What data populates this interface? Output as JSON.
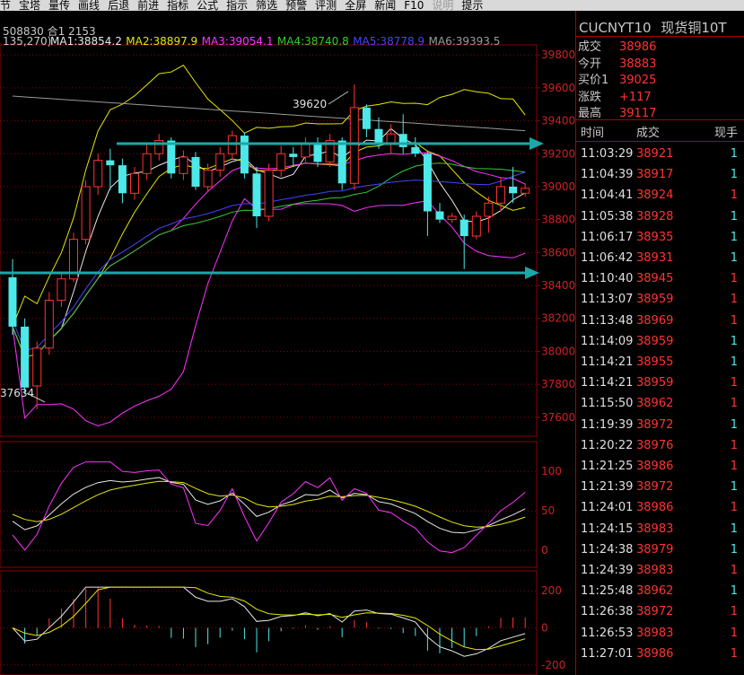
{
  "menu": [
    {
      "label": "节",
      "dim": false
    },
    {
      "label": "宝塔",
      "dim": false
    },
    {
      "label": "量传",
      "dim": false
    },
    {
      "label": "画线",
      "dim": false
    },
    {
      "label": "后退",
      "dim": false
    },
    {
      "label": "前进",
      "dim": false
    },
    {
      "label": "指标",
      "dim": false
    },
    {
      "label": "公式",
      "dim": false
    },
    {
      "label": "指示",
      "dim": false
    },
    {
      "label": "筛选",
      "dim": false
    },
    {
      "label": "预警",
      "dim": false
    },
    {
      "label": "评测",
      "dim": false
    },
    {
      "label": "全屏",
      "dim": false
    },
    {
      "label": "新闻",
      "dim": false
    },
    {
      "label": "F10",
      "dim": false
    },
    {
      "label": "说明",
      "dim": true
    },
    {
      "label": "提示",
      "dim": false
    }
  ],
  "info_line": "508830  合1 2153",
  "ma_legend": {
    "prefix": "135,270)",
    "items": [
      {
        "label": "MA1:38854.2",
        "color": "#e8e8e8"
      },
      {
        "label": "MA2:38897.9",
        "color": "#e6e600"
      },
      {
        "label": "MA3:39054.1",
        "color": "#ff33ff"
      },
      {
        "label": "MA4:38740.8",
        "color": "#33cc33"
      },
      {
        "label": "MA5:38778.9",
        "color": "#4444ff"
      },
      {
        "label": "MA6:39393.5",
        "color": "#9a9a9a"
      }
    ]
  },
  "price_axis": [
    "39800",
    "39600",
    "39400",
    "39200",
    "39000",
    "38800",
    "38600",
    "38400",
    "38200",
    "38000",
    "37800",
    "37600"
  ],
  "annotations": {
    "high": "39620",
    "low": "37634"
  },
  "kdj_axis": [
    "100",
    "50",
    "0"
  ],
  "macd_axis": [
    "200",
    "0",
    "-200"
  ],
  "colors": {
    "up": "#ff3333",
    "down": "#4de8e8",
    "grid": "#8b0000",
    "arrow": "#1aa8a8"
  },
  "symbol": {
    "code": "CUCNYT10",
    "name": "现货铜10T"
  },
  "quote": [
    {
      "label": "成交",
      "value": "38986"
    },
    {
      "label": "今开",
      "value": "38883"
    },
    {
      "label": "买价1",
      "value": "39025"
    },
    {
      "label": "涨跌",
      "value": "+117"
    },
    {
      "label": "最高",
      "value": "39117"
    }
  ],
  "tick_headers": {
    "time": "时间",
    "price": "成交",
    "qty": "现手"
  },
  "ticks": [
    {
      "time": "11:03:29",
      "price": "38921",
      "qty": "1",
      "dir": "down"
    },
    {
      "time": "11:04:39",
      "price": "38917",
      "qty": "1",
      "dir": "down"
    },
    {
      "time": "11:04:41",
      "price": "38924",
      "qty": "1",
      "dir": "up"
    },
    {
      "time": "11:05:38",
      "price": "38928",
      "qty": "1",
      "dir": "down"
    },
    {
      "time": "11:06:17",
      "price": "38935",
      "qty": "1",
      "dir": "down"
    },
    {
      "time": "11:06:42",
      "price": "38931",
      "qty": "1",
      "dir": "down"
    },
    {
      "time": "11:10:40",
      "price": "38945",
      "qty": "1",
      "dir": "up"
    },
    {
      "time": "11:13:07",
      "price": "38959",
      "qty": "1",
      "dir": "up"
    },
    {
      "time": "11:13:48",
      "price": "38969",
      "qty": "1",
      "dir": "up"
    },
    {
      "time": "11:14:09",
      "price": "38959",
      "qty": "1",
      "dir": "down"
    },
    {
      "time": "11:14:21",
      "price": "38955",
      "qty": "1",
      "dir": "down"
    },
    {
      "time": "11:14:21",
      "price": "38959",
      "qty": "1",
      "dir": "up"
    },
    {
      "time": "11:15:50",
      "price": "38962",
      "qty": "1",
      "dir": "up"
    },
    {
      "time": "11:19:39",
      "price": "38972",
      "qty": "1",
      "dir": "down"
    },
    {
      "time": "11:20:22",
      "price": "38976",
      "qty": "1",
      "dir": "up"
    },
    {
      "time": "11:21:25",
      "price": "38986",
      "qty": "1",
      "dir": "up"
    },
    {
      "time": "11:21:39",
      "price": "38972",
      "qty": "1",
      "dir": "down"
    },
    {
      "time": "11:24:01",
      "price": "38986",
      "qty": "1",
      "dir": "up"
    },
    {
      "time": "11:24:15",
      "price": "38983",
      "qty": "1",
      "dir": "down"
    },
    {
      "time": "11:24:38",
      "price": "38979",
      "qty": "1",
      "dir": "down"
    },
    {
      "time": "11:24:39",
      "price": "38983",
      "qty": "1",
      "dir": "up"
    },
    {
      "time": "11:25:48",
      "price": "38962",
      "qty": "1",
      "dir": "down"
    },
    {
      "time": "11:26:38",
      "price": "38972",
      "qty": "1",
      "dir": "up"
    },
    {
      "time": "11:26:53",
      "price": "38983",
      "qty": "1",
      "dir": "up"
    },
    {
      "time": "11:27:01",
      "price": "38986",
      "qty": "1",
      "dir": "up"
    }
  ],
  "chart_data": {
    "type": "candlestick",
    "y_range": [
      37550,
      39850
    ],
    "candles": [
      {
        "o": 38450,
        "c": 38150,
        "h": 38560,
        "l": 38100
      },
      {
        "o": 38150,
        "c": 37780,
        "h": 38200,
        "l": 37740
      },
      {
        "o": 37790,
        "c": 38020,
        "h": 38060,
        "l": 37650
      },
      {
        "o": 38020,
        "c": 38310,
        "h": 38360,
        "l": 37980
      },
      {
        "o": 38310,
        "c": 38440,
        "h": 38480,
        "l": 38270
      },
      {
        "o": 38440,
        "c": 38680,
        "h": 38720,
        "l": 38420
      },
      {
        "o": 38680,
        "c": 39000,
        "h": 39040,
        "l": 38650
      },
      {
        "o": 39000,
        "c": 39160,
        "h": 39200,
        "l": 38950
      },
      {
        "o": 39160,
        "c": 39130,
        "h": 39230,
        "l": 38980
      },
      {
        "o": 39130,
        "c": 38960,
        "h": 39170,
        "l": 38900
      },
      {
        "o": 38960,
        "c": 39080,
        "h": 39120,
        "l": 38920
      },
      {
        "o": 39080,
        "c": 39200,
        "h": 39260,
        "l": 39040
      },
      {
        "o": 39200,
        "c": 39280,
        "h": 39320,
        "l": 39160
      },
      {
        "o": 39280,
        "c": 39080,
        "h": 39300,
        "l": 39050
      },
      {
        "o": 39080,
        "c": 39180,
        "h": 39220,
        "l": 39040
      },
      {
        "o": 39180,
        "c": 39000,
        "h": 39210,
        "l": 38980
      },
      {
        "o": 39000,
        "c": 39100,
        "h": 39140,
        "l": 38970
      },
      {
        "o": 39100,
        "c": 39200,
        "h": 39240,
        "l": 39060
      },
      {
        "o": 39200,
        "c": 39310,
        "h": 39340,
        "l": 39170
      },
      {
        "o": 39310,
        "c": 39080,
        "h": 39330,
        "l": 39050
      },
      {
        "o": 39080,
        "c": 38820,
        "h": 39120,
        "l": 38750
      },
      {
        "o": 38820,
        "c": 39100,
        "h": 39140,
        "l": 38790
      },
      {
        "o": 39100,
        "c": 39200,
        "h": 39250,
        "l": 39060
      },
      {
        "o": 39200,
        "c": 39180,
        "h": 39240,
        "l": 39120
      },
      {
        "o": 39180,
        "c": 39260,
        "h": 39300,
        "l": 39150
      },
      {
        "o": 39260,
        "c": 39150,
        "h": 39300,
        "l": 39120
      },
      {
        "o": 39150,
        "c": 39280,
        "h": 39320,
        "l": 39120
      },
      {
        "o": 39280,
        "c": 39020,
        "h": 39300,
        "l": 38980
      },
      {
        "o": 39020,
        "c": 39480,
        "h": 39620,
        "l": 38980
      },
      {
        "o": 39480,
        "c": 39350,
        "h": 39500,
        "l": 39300
      },
      {
        "o": 39350,
        "c": 39260,
        "h": 39420,
        "l": 39230
      },
      {
        "o": 39260,
        "c": 39320,
        "h": 39380,
        "l": 39200
      },
      {
        "o": 39320,
        "c": 39240,
        "h": 39440,
        "l": 39200
      },
      {
        "o": 39240,
        "c": 39200,
        "h": 39300,
        "l": 39180
      },
      {
        "o": 39200,
        "c": 38850,
        "h": 39220,
        "l": 38700
      },
      {
        "o": 38850,
        "c": 38800,
        "h": 38900,
        "l": 38780
      },
      {
        "o": 38800,
        "c": 38820,
        "h": 38840,
        "l": 38780
      },
      {
        "o": 38800,
        "c": 38700,
        "h": 38830,
        "l": 38500
      },
      {
        "o": 38700,
        "c": 38820,
        "h": 38850,
        "l": 38680
      },
      {
        "o": 38820,
        "c": 38900,
        "h": 38940,
        "l": 38720
      },
      {
        "o": 38900,
        "c": 39000,
        "h": 39060,
        "l": 38850
      },
      {
        "o": 39000,
        "c": 38960,
        "h": 39120,
        "l": 38900
      },
      {
        "o": 38960,
        "c": 38990,
        "h": 39020,
        "l": 38940
      }
    ]
  }
}
